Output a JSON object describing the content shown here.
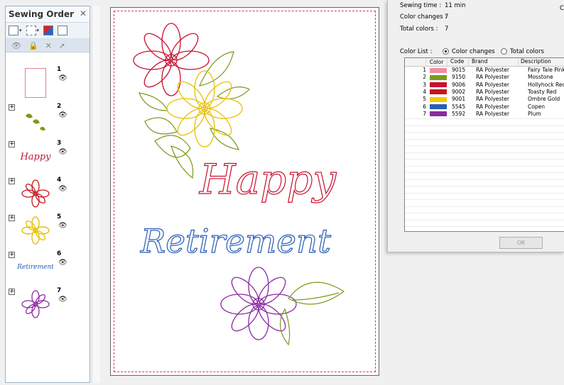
{
  "sewing_order": {
    "title": "Sewing Order",
    "items": [
      {
        "num": "1",
        "expandable": false
      },
      {
        "num": "2",
        "expandable": true
      },
      {
        "num": "3",
        "expandable": true
      },
      {
        "num": "4",
        "expandable": true
      },
      {
        "num": "5",
        "expandable": true
      },
      {
        "num": "6",
        "expandable": true
      },
      {
        "num": "7",
        "expandable": true
      }
    ]
  },
  "design": {
    "word1": "Happy",
    "word2": "Retirement",
    "colors": {
      "pink": "#e06080",
      "green": "#7a9a2a",
      "red": "#c01838",
      "gold": "#e8c000",
      "blue": "#3a6ac0",
      "purple": "#9030b0"
    }
  },
  "dialog": {
    "sewing_time_label": "Sewing time :",
    "sewing_time_value": "11 min",
    "color_changes_label": "Color changes :",
    "color_changes_value": "7",
    "total_colors_label": "Total colors :",
    "total_colors_value": "7",
    "color_list_label": "Color List :",
    "radio_color_changes": "Color changes",
    "radio_total_colors": "Total colors",
    "partial_right": "C",
    "ok_label": "OK",
    "columns": [
      "Color",
      "Code",
      "Brand",
      "Description"
    ],
    "rows": [
      {
        "n": "1",
        "color": "#f08ca0",
        "code": "9015",
        "brand": "RA Polyester",
        "desc": "Fairy Tale Pink"
      },
      {
        "n": "2",
        "color": "#7a9a1c",
        "code": "9150",
        "brand": "RA Polyester",
        "desc": "Mosstone"
      },
      {
        "n": "3",
        "color": "#c8102e",
        "code": "9006",
        "brand": "RA Polyester",
        "desc": "Hollyhock Red"
      },
      {
        "n": "4",
        "color": "#c4161c",
        "code": "9002",
        "brand": "RA Polyester",
        "desc": "Toasty Red"
      },
      {
        "n": "5",
        "color": "#f5c800",
        "code": "9001",
        "brand": "RA Polyester",
        "desc": "Ombre Gold"
      },
      {
        "n": "6",
        "color": "#2a5cb8",
        "code": "5545",
        "brand": "RA Polyester",
        "desc": "Copen"
      },
      {
        "n": "7",
        "color": "#8a2aa0",
        "code": "5592",
        "brand": "RA Polyester",
        "desc": "Plum"
      }
    ]
  }
}
